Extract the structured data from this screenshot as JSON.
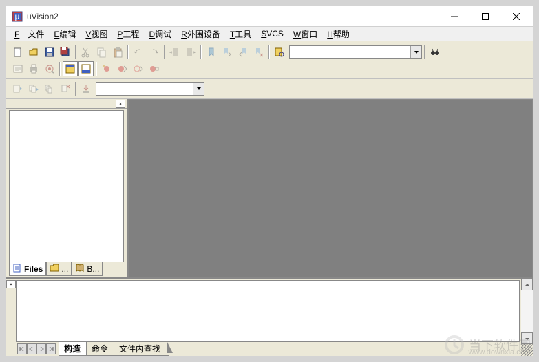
{
  "window": {
    "title": "uVision2"
  },
  "menu": {
    "file": "F文件",
    "edit": "E编辑",
    "view": "V视图",
    "project": "P工程",
    "debug": "D调试",
    "peripherals": "R外围设备",
    "tools": "T工具",
    "svcs": "SVCS",
    "window": "W窗口",
    "help": "H帮助"
  },
  "combos": {
    "find": "",
    "target": ""
  },
  "project_tabs": {
    "files": "Files",
    "regs": "...",
    "books": "B..."
  },
  "output_tabs": {
    "build": "构造",
    "command": "命令",
    "find": "文件内查找"
  },
  "watermark": {
    "text": "当下软件园",
    "url": "www.downxia.com"
  },
  "colors": {
    "frame": "#5a8cc0",
    "toolbar": "#ece9d8",
    "editor_bg": "#808080"
  }
}
